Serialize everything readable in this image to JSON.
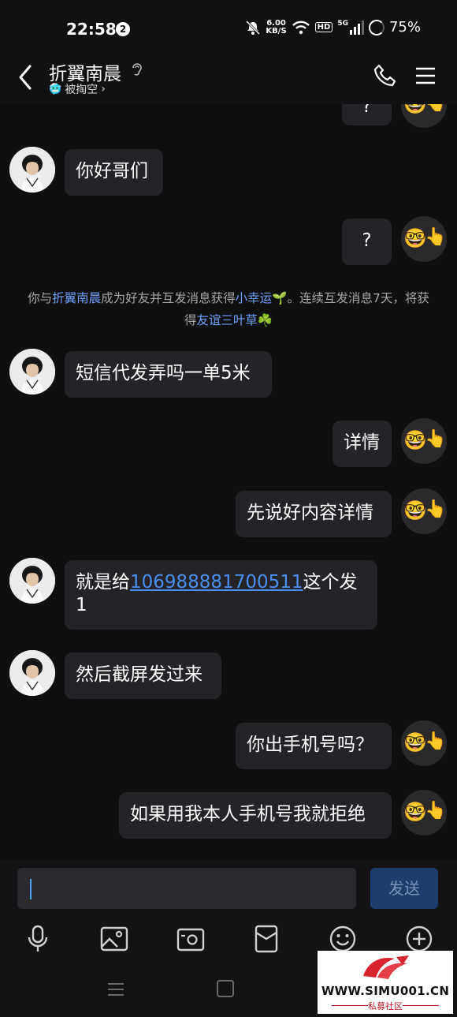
{
  "status_bar": {
    "time": "22:58",
    "notification_count": "2",
    "net_speed_value": "6.00",
    "net_speed_unit": "KB/S",
    "hd_label": "HD",
    "network_label": "5G",
    "battery": "75%"
  },
  "header": {
    "title": "折翼南晨",
    "subtitle": "被掏空",
    "subtitle_chevron": "›"
  },
  "messages": [
    {
      "side": "right",
      "text": "?"
    },
    {
      "side": "left",
      "text": "你好哥们"
    },
    {
      "side": "right",
      "text": "?"
    },
    {
      "side": "left",
      "text": "短信代发弄吗一单5米"
    },
    {
      "side": "right",
      "text": "详情"
    },
    {
      "side": "right",
      "text": "先说好内容详情"
    },
    {
      "side": "left",
      "text_before": "就是给",
      "link": "106988881700511",
      "text_after": "这个发1"
    },
    {
      "side": "left",
      "text": "然后截屏发过来"
    },
    {
      "side": "right",
      "text": "你出手机号吗？"
    },
    {
      "side": "right",
      "text": "如果用我本人手机号我就拒绝"
    }
  ],
  "system_notice": {
    "part1": "你与",
    "friend_name": "折翼南晨",
    "part2": "成为好友并互发消息获得",
    "reward1": "小幸运",
    "part3": "。连续互发消息7天，将获得",
    "reward2": "友谊三叶草"
  },
  "input_bar": {
    "send_label": "发送"
  },
  "watermark": {
    "url": "WWW.SIMU001.CN",
    "label": "私募社区"
  },
  "colors": {
    "background": "#0f0f10",
    "bubble": "#242428",
    "link": "#4a8ff2",
    "highlight": "#6ea2ff",
    "send_button": "#1d3d6a"
  }
}
